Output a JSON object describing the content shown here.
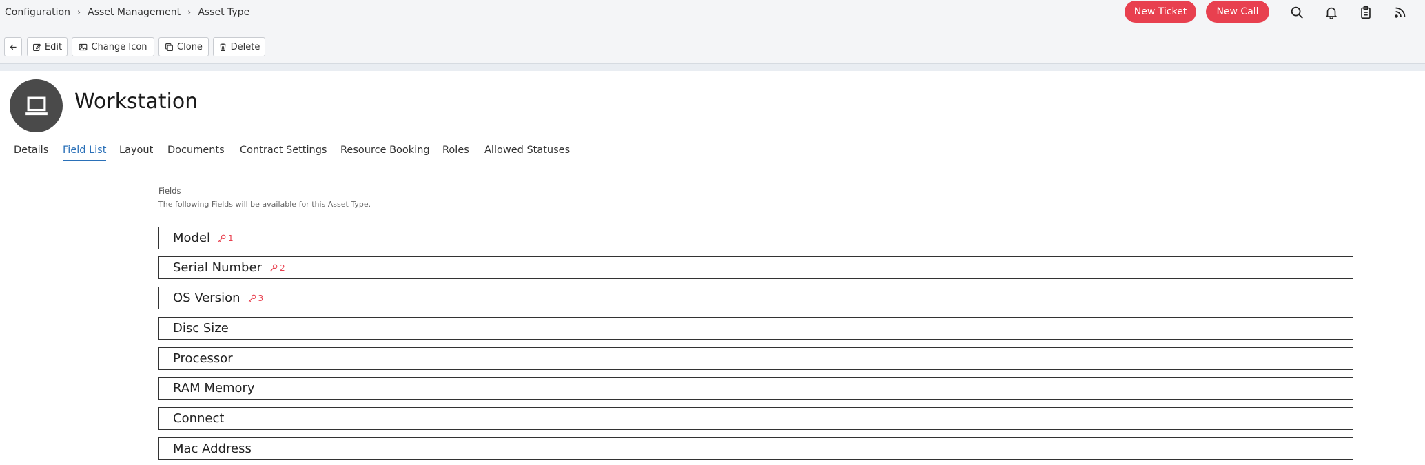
{
  "breadcrumb": [
    "Configuration",
    "Asset Management",
    "Asset Type"
  ],
  "header": {
    "new_ticket_label": "New Ticket",
    "new_call_label": "New Call",
    "accent_color": "#e8404f"
  },
  "actions": {
    "back_icon": "arrow-left-icon",
    "edit_label": "Edit",
    "change_icon_label": "Change Icon",
    "clone_label": "Clone",
    "delete_label": "Delete"
  },
  "page": {
    "title": "Workstation",
    "avatar_icon": "laptop-icon"
  },
  "tabs": [
    {
      "label": "Details",
      "active": false
    },
    {
      "label": "Field List",
      "active": true
    },
    {
      "label": "Layout",
      "active": false
    },
    {
      "label": "Documents",
      "active": false
    },
    {
      "label": "Contract Settings",
      "active": false
    },
    {
      "label": "Resource Booking",
      "active": false
    },
    {
      "label": "Roles",
      "active": false
    },
    {
      "label": "Allowed Statuses",
      "active": false
    }
  ],
  "fields_section": {
    "title": "Fields",
    "subtitle": "The following Fields will be available for this Asset Type.",
    "fields": [
      {
        "name": "Model",
        "key": "1"
      },
      {
        "name": "Serial Number",
        "key": "2"
      },
      {
        "name": "OS Version",
        "key": "3"
      },
      {
        "name": "Disc Size",
        "key": null
      },
      {
        "name": "Processor",
        "key": null
      },
      {
        "name": "RAM Memory",
        "key": null
      },
      {
        "name": "Connect",
        "key": null
      },
      {
        "name": "Mac Address",
        "key": null
      }
    ]
  }
}
